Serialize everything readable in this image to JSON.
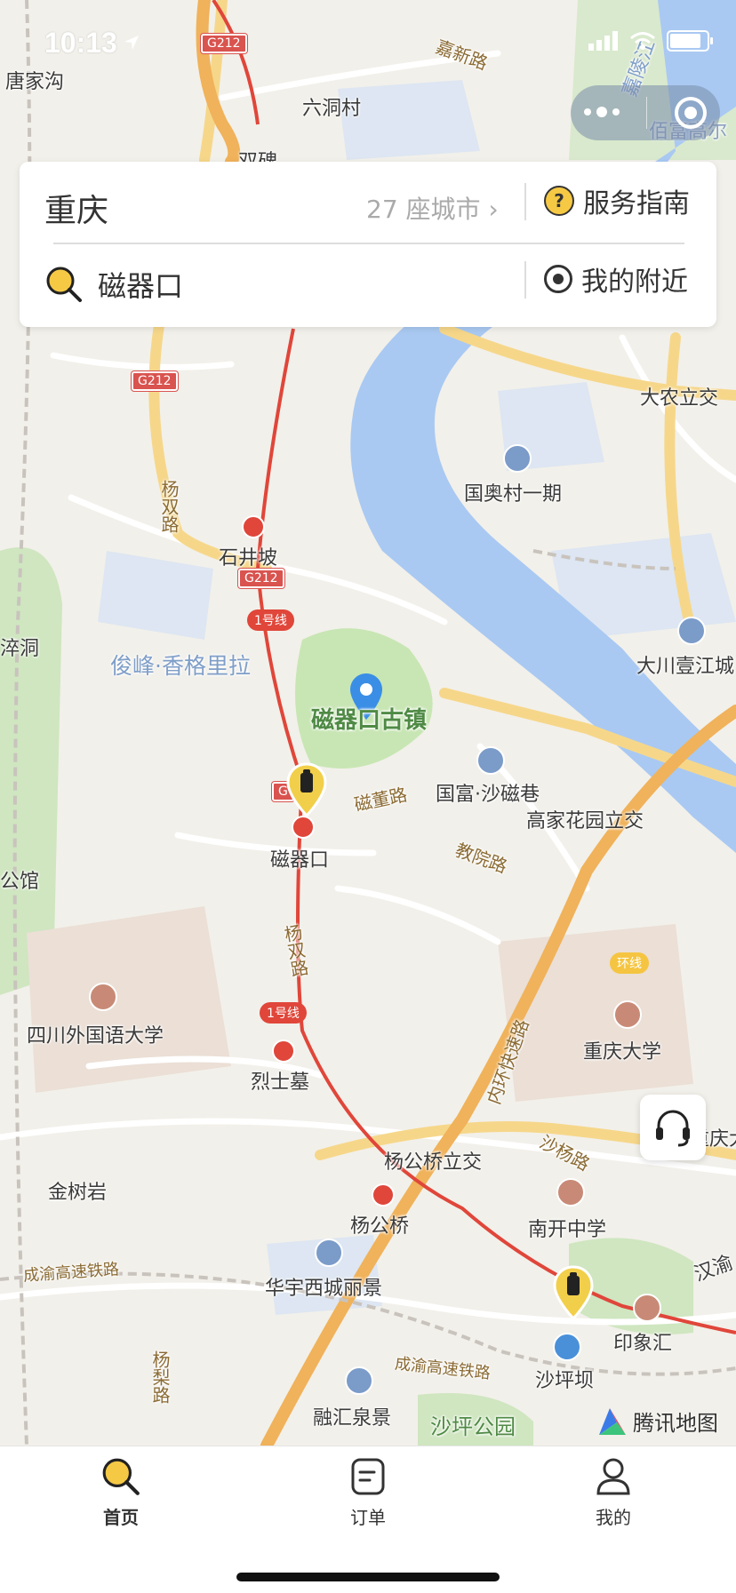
{
  "status_bar": {
    "time": "10:13",
    "icons": [
      "signal-icon",
      "wifi-icon",
      "battery-icon"
    ]
  },
  "capsule": {
    "icons": [
      "more-icon",
      "close-target-icon"
    ]
  },
  "search_card": {
    "city": "重庆",
    "city_count": "27 座城市",
    "guide_label": "服务指南",
    "search_value": "磁器口",
    "search_placeholder": "",
    "nearby_label": "我的附近"
  },
  "map": {
    "labels": {
      "tangjiagou": "唐家沟",
      "liudongcun": "六洞村",
      "jiaxinlu": "嘉新路",
      "jialingjiang": "嘉陵江",
      "baifu": "佰富高尔",
      "shuangbei": "双碑",
      "danongli": "大农立交",
      "guoaocun": "国奥村一期",
      "yangshuanglu1": "杨双路",
      "shijingpo": "石井坡",
      "dachuan": "大川壹江城",
      "jundong": "淬洞",
      "junfeng": "俊峰·香格里拉",
      "ciqikou_town": "磁器口古镇",
      "guofu": "国富·沙磁巷",
      "cidonglu": "磁董路",
      "gaojia": "高家花园立交",
      "ciqikou": "磁器口",
      "jiaoyuanlu": "教院路",
      "gongguan": "公馆",
      "yangshuanglu2": "杨双路",
      "neihuan": "内环快速路",
      "huanxian": "环线",
      "sichuan_uni": "四川外国语大学",
      "chongqing_uni": "重庆大学",
      "lieshimu": "烈士墓",
      "jinshuyan": "金树岩",
      "yanggongqiao_lijiao": "杨公桥立交",
      "shayanglu": "沙杨路",
      "yanggongqiao": "杨公桥",
      "nankai": "南开中学",
      "chengyu1": "成渝高速铁路",
      "huayu": "华宇西城丽景",
      "yinxianghui": "印象汇",
      "yanglilu": "杨梨路",
      "chengyu2": "成渝高速铁路",
      "shapingba": "沙坪坝",
      "ronghui": "融汇泉景",
      "shaping_park": "沙坪公园",
      "hanyu": "汉渝",
      "chongqingda2": "重庆大"
    },
    "shields": {
      "g212_top": "G212",
      "g212_mid": "G212",
      "g212_low": "G212",
      "g212_ciqi": "G"
    },
    "line_badges": {
      "line1_a": "1号线",
      "line1_b": "1号线"
    },
    "brand_label": "腾讯地图",
    "colors": {
      "river": "#a9c9f2",
      "park": "#c8e6b4",
      "highway": "#f0b25a",
      "metro": "#e0463a",
      "accent": "#f6c945"
    }
  },
  "tabs": [
    {
      "label": "首页",
      "icon": "search-icon",
      "active": true
    },
    {
      "label": "订单",
      "icon": "order-icon",
      "active": false
    },
    {
      "label": "我的",
      "icon": "user-icon",
      "active": false
    }
  ]
}
